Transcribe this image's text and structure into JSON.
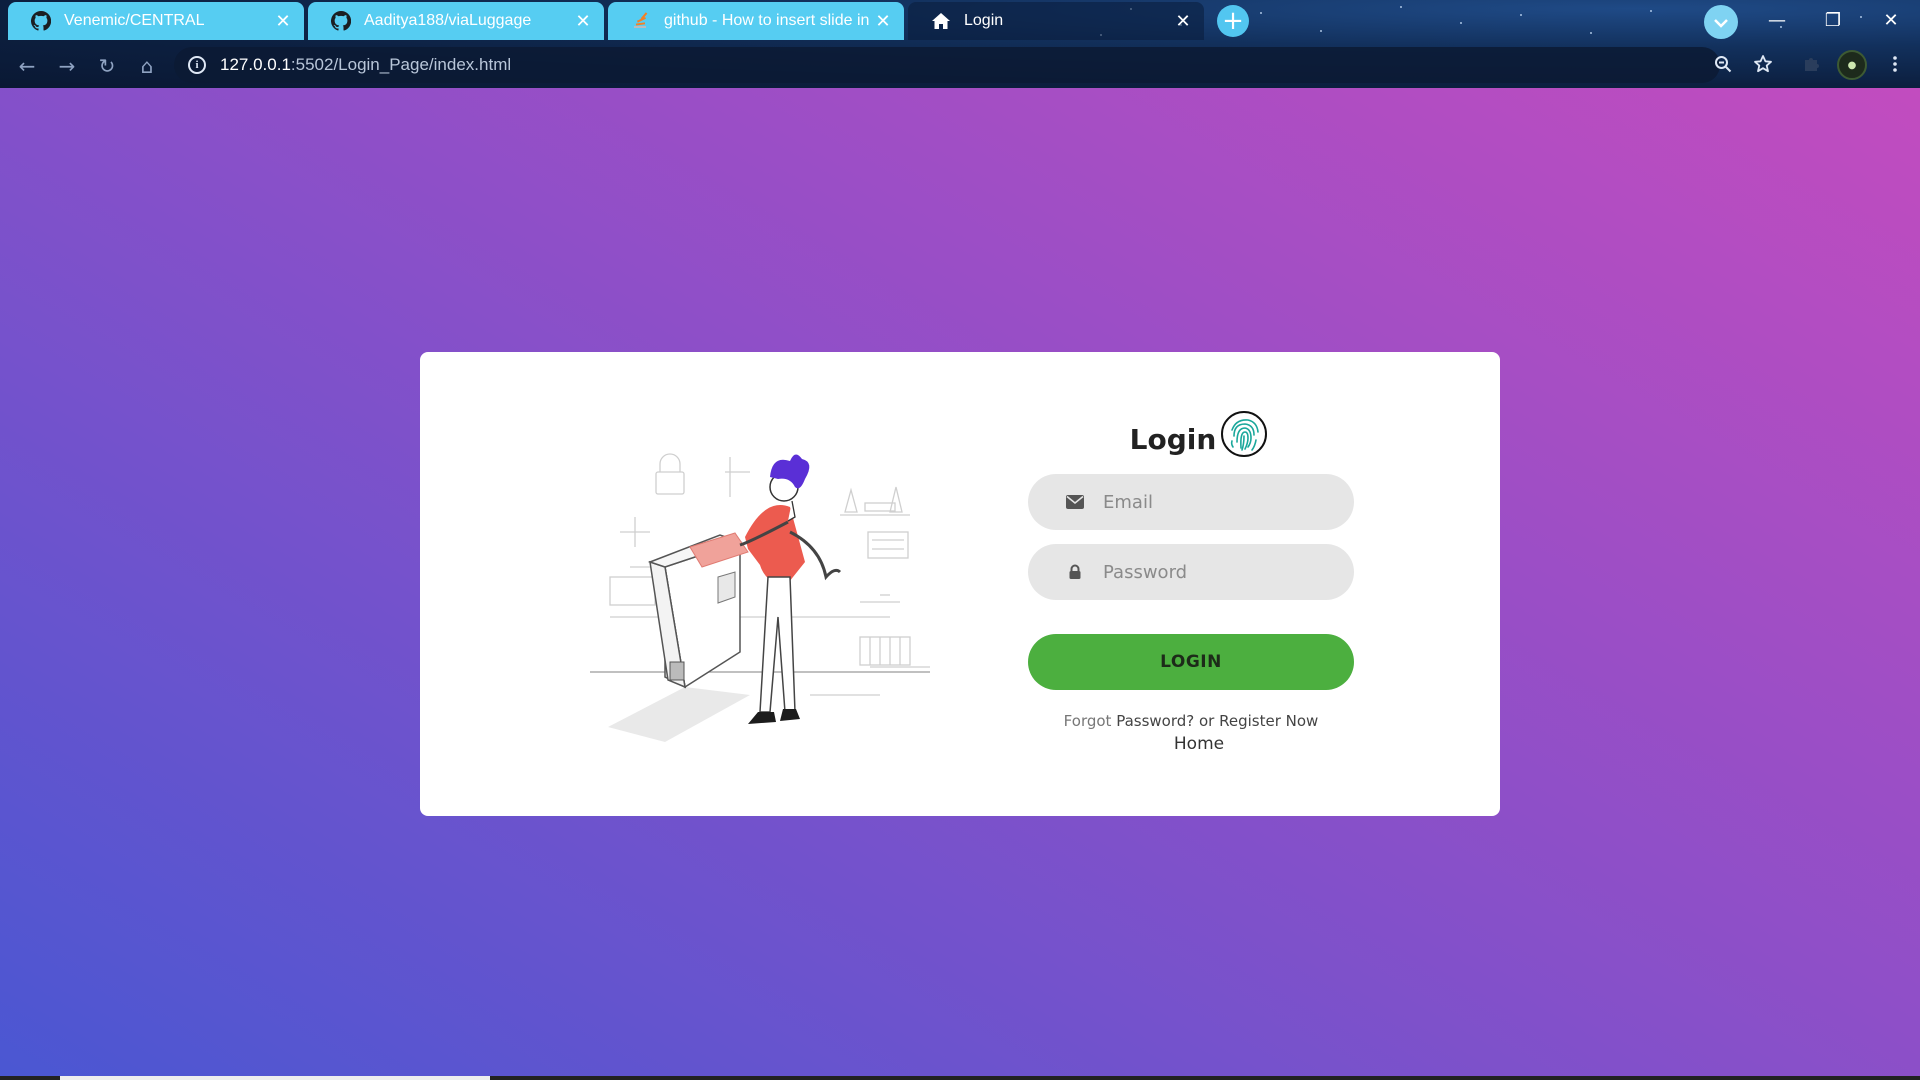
{
  "browser": {
    "tabs": [
      {
        "title": "Venemic/CENTRAL",
        "icon": "github-icon",
        "active": false
      },
      {
        "title": "Aaditya188/viaLuggage",
        "icon": "github-icon",
        "active": false
      },
      {
        "title": "github - How to insert slide in RE",
        "icon": "stackoverflow-icon",
        "active": false
      },
      {
        "title": "Login",
        "icon": "home-icon",
        "active": true
      }
    ],
    "new_tab_label": "+",
    "url_host": "127.0.0.1",
    "url_rest": ":5502/Login_Page/index.html",
    "window_controls": {
      "minimize": "—",
      "restore": "❐",
      "close": "✕"
    }
  },
  "login": {
    "title": "Login",
    "email_placeholder": "Email",
    "password_placeholder": "Password",
    "button_label": "LOGIN",
    "forgot_prefix": "Forgot ",
    "forgot_link": "Password?",
    "or_text": " or ",
    "register_link": "Register Now",
    "home_link": "Home"
  },
  "colors": {
    "button_green": "#4caf3f",
    "gradient_start": "#4a57d2",
    "gradient_end": "#c24cbf",
    "tab_bg": "#56cdf2"
  }
}
